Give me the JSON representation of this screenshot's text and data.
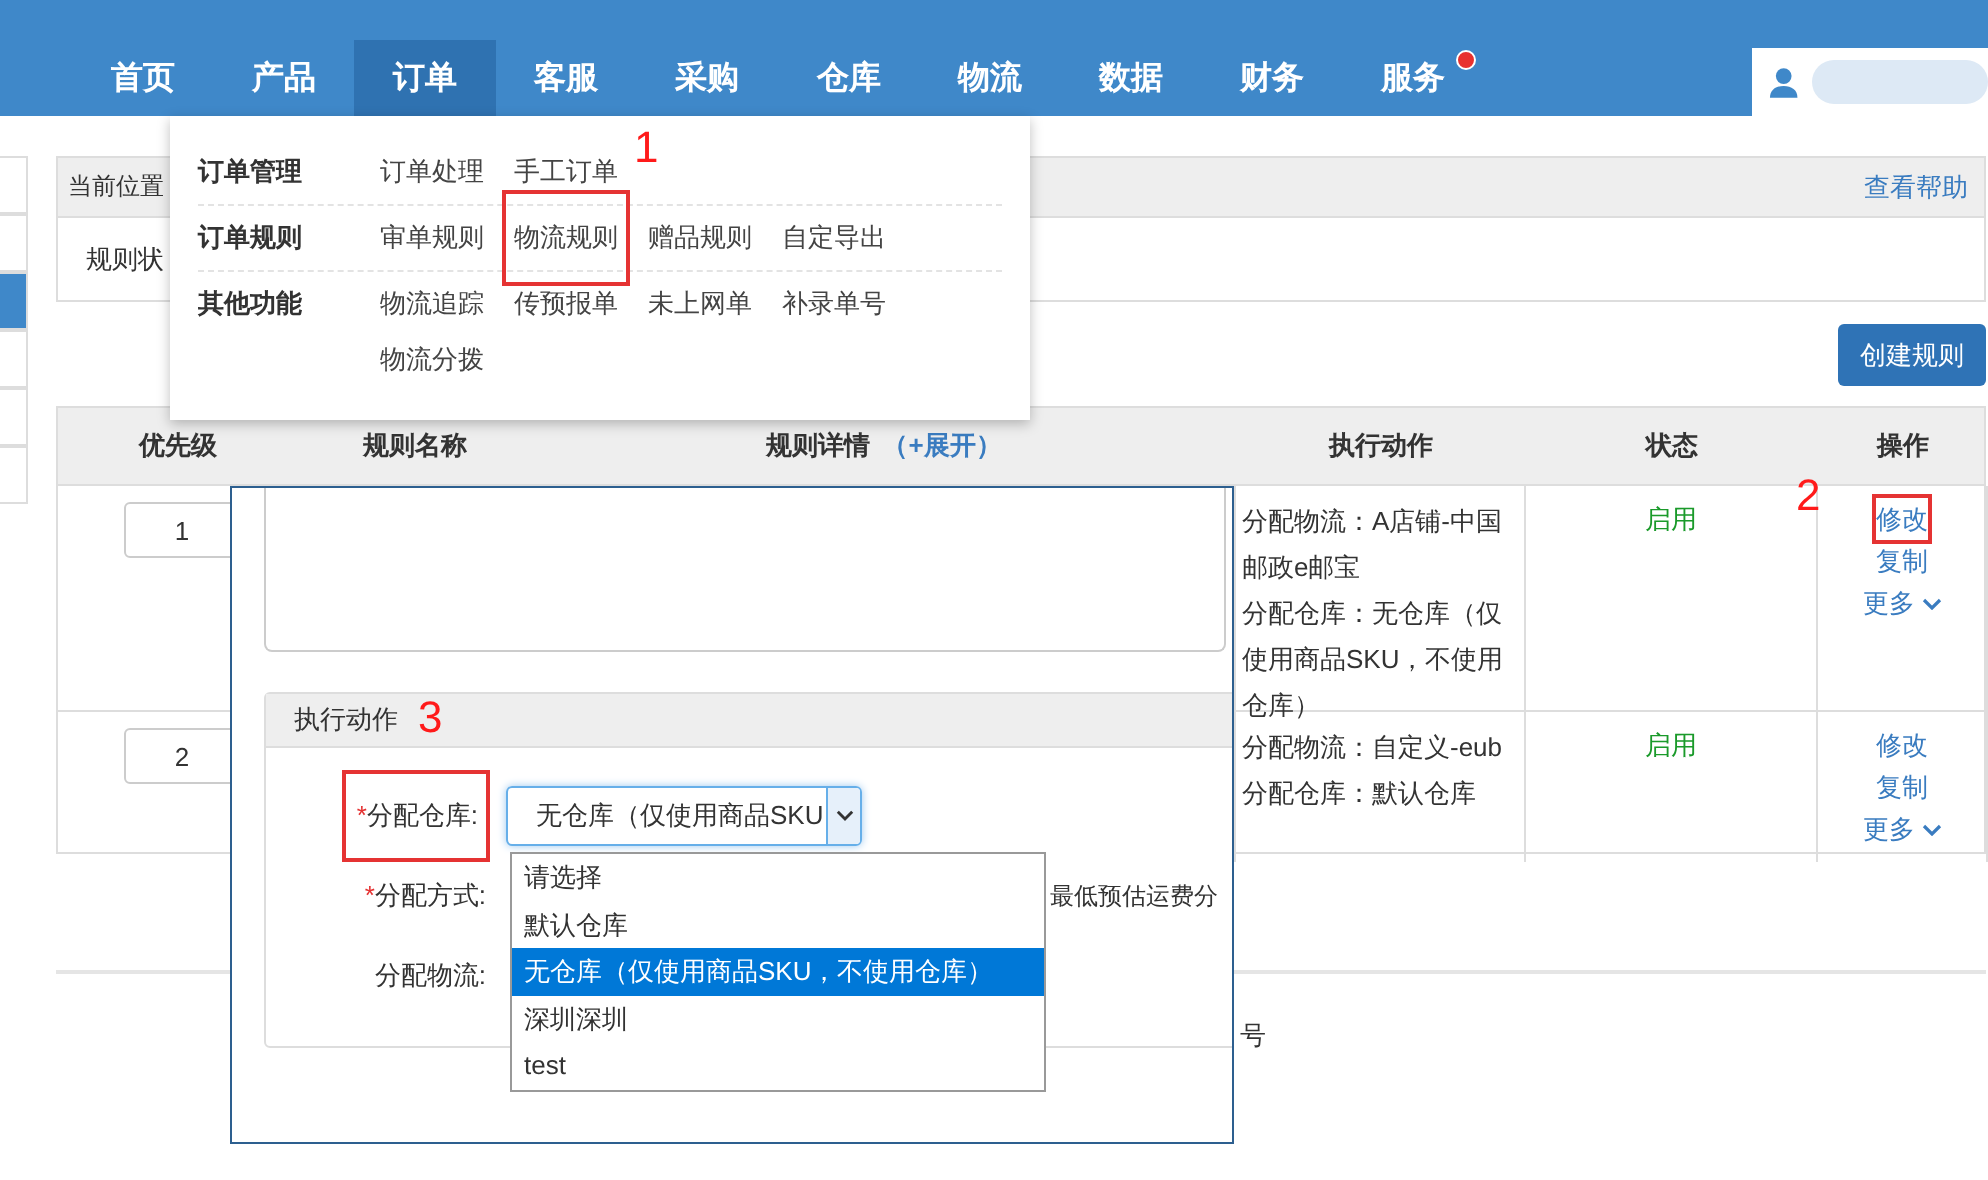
{
  "nav": {
    "items": [
      {
        "label": "首页",
        "selected": false,
        "badge": false
      },
      {
        "label": "产品",
        "selected": false,
        "badge": false
      },
      {
        "label": "订单",
        "selected": true,
        "badge": false
      },
      {
        "label": "客服",
        "selected": false,
        "badge": false
      },
      {
        "label": "采购",
        "selected": false,
        "badge": false
      },
      {
        "label": "仓库",
        "selected": false,
        "badge": false
      },
      {
        "label": "物流",
        "selected": false,
        "badge": false
      },
      {
        "label": "数据",
        "selected": false,
        "badge": false
      },
      {
        "label": "财务",
        "selected": false,
        "badge": false
      },
      {
        "label": "服务",
        "selected": false,
        "badge": true
      }
    ]
  },
  "sidebar": {
    "items": [
      {
        "selected": false
      },
      {
        "selected": false
      },
      {
        "selected": true
      },
      {
        "selected": false
      },
      {
        "selected": false
      },
      {
        "selected": false
      }
    ]
  },
  "menu": {
    "groups": [
      {
        "title": "订单管理",
        "items": [
          {
            "label": "订单处理",
            "highlighted": false
          },
          {
            "label": "手工订单",
            "highlighted": false
          }
        ]
      },
      {
        "title": "订单规则",
        "items": [
          {
            "label": "审单规则",
            "highlighted": false
          },
          {
            "label": "物流规则",
            "highlighted": true,
            "annotation": "1"
          },
          {
            "label": "赠品规则",
            "highlighted": false
          },
          {
            "label": "自定导出",
            "highlighted": false
          }
        ]
      },
      {
        "title": "其他功能",
        "items": [
          {
            "label": "物流追踪",
            "highlighted": false
          },
          {
            "label": "传预报单",
            "highlighted": false
          },
          {
            "label": "未上网单",
            "highlighted": false
          },
          {
            "label": "补录单号",
            "highlighted": false
          },
          {
            "label": "物流分拨",
            "highlighted": false
          }
        ]
      }
    ]
  },
  "breadcrumb": {
    "label": "当前位置",
    "help": "查看帮助"
  },
  "filter": {
    "label": "规则状"
  },
  "create_button": "创建规则",
  "table": {
    "columns": [
      "优先级",
      "规则名称",
      "规则详情",
      "执行动作",
      "状态",
      "操作"
    ],
    "expand": "（+展开）",
    "rows": [
      {
        "priority": "1",
        "actions": [
          "分配物流：A店铺-中国邮政e邮宝",
          "分配仓库：无仓库（仅使用商品SKU，不使用仓库）"
        ],
        "status": "启用",
        "ops": [
          {
            "label": "修改",
            "highlighted": true,
            "annotation": "2"
          },
          {
            "label": "复制",
            "highlighted": false
          },
          {
            "label": "更多",
            "highlighted": false
          }
        ]
      },
      {
        "priority": "2",
        "actions": [
          "分配物流：自定义-eub",
          "分配仓库：默认仓库"
        ],
        "status": "启用",
        "ops": [
          {
            "label": "修改",
            "highlighted": false
          },
          {
            "label": "复制",
            "highlighted": false
          },
          {
            "label": "更多",
            "highlighted": false
          }
        ]
      }
    ]
  },
  "footer_fragment": "号",
  "modal": {
    "section": {
      "title": "执行动作",
      "annotation": "3"
    },
    "fields": [
      {
        "kind": "select",
        "required_mark": "*",
        "label": "分配仓库:",
        "highlighted": true,
        "value": "无仓库（仅使用商品SKU"
      },
      {
        "kind": "text",
        "required_mark": "*",
        "label": "分配方式:",
        "highlighted": false,
        "value": "最低预估运费分"
      },
      {
        "kind": "empty",
        "label": "分配物流:",
        "highlighted": false
      }
    ],
    "options": [
      {
        "label": "请选择",
        "selected": false
      },
      {
        "label": "默认仓库",
        "selected": false
      },
      {
        "label": "无仓库（仅使用商品SKU，不使用仓库）",
        "selected": true
      },
      {
        "label": "深圳深圳",
        "selected": false
      },
      {
        "label": "test",
        "selected": false
      }
    ]
  }
}
